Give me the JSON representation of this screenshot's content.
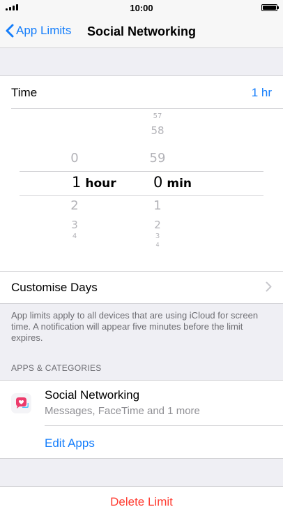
{
  "status_bar": {
    "time": "10:00"
  },
  "nav": {
    "back_label": "App Limits",
    "title": "Social Networking"
  },
  "time_row": {
    "label": "Time",
    "value": "1 hr"
  },
  "picker": {
    "hours": {
      "above": [
        "0"
      ],
      "selected": "1",
      "unit": "hour",
      "below": [
        "2",
        "3",
        "4"
      ]
    },
    "minutes": {
      "above": [
        "57",
        "58",
        "59"
      ],
      "selected": "0",
      "unit": "min",
      "below": [
        "1",
        "2",
        "3",
        "4"
      ]
    }
  },
  "customise_days": {
    "label": "Customise Days"
  },
  "footnote": "App limits apply to all devices that are using iCloud for screen time. A notification will appear five minutes before the limit expires.",
  "apps_section": {
    "header": "APPS & CATEGORIES",
    "item": {
      "title": "Social Networking",
      "subtitle": "Messages, FaceTime and 1 more"
    },
    "edit_label": "Edit Apps"
  },
  "delete_label": "Delete Limit",
  "colors": {
    "accent": "#157efb",
    "destructive": "#ff3b30",
    "background": "#efeff4"
  }
}
